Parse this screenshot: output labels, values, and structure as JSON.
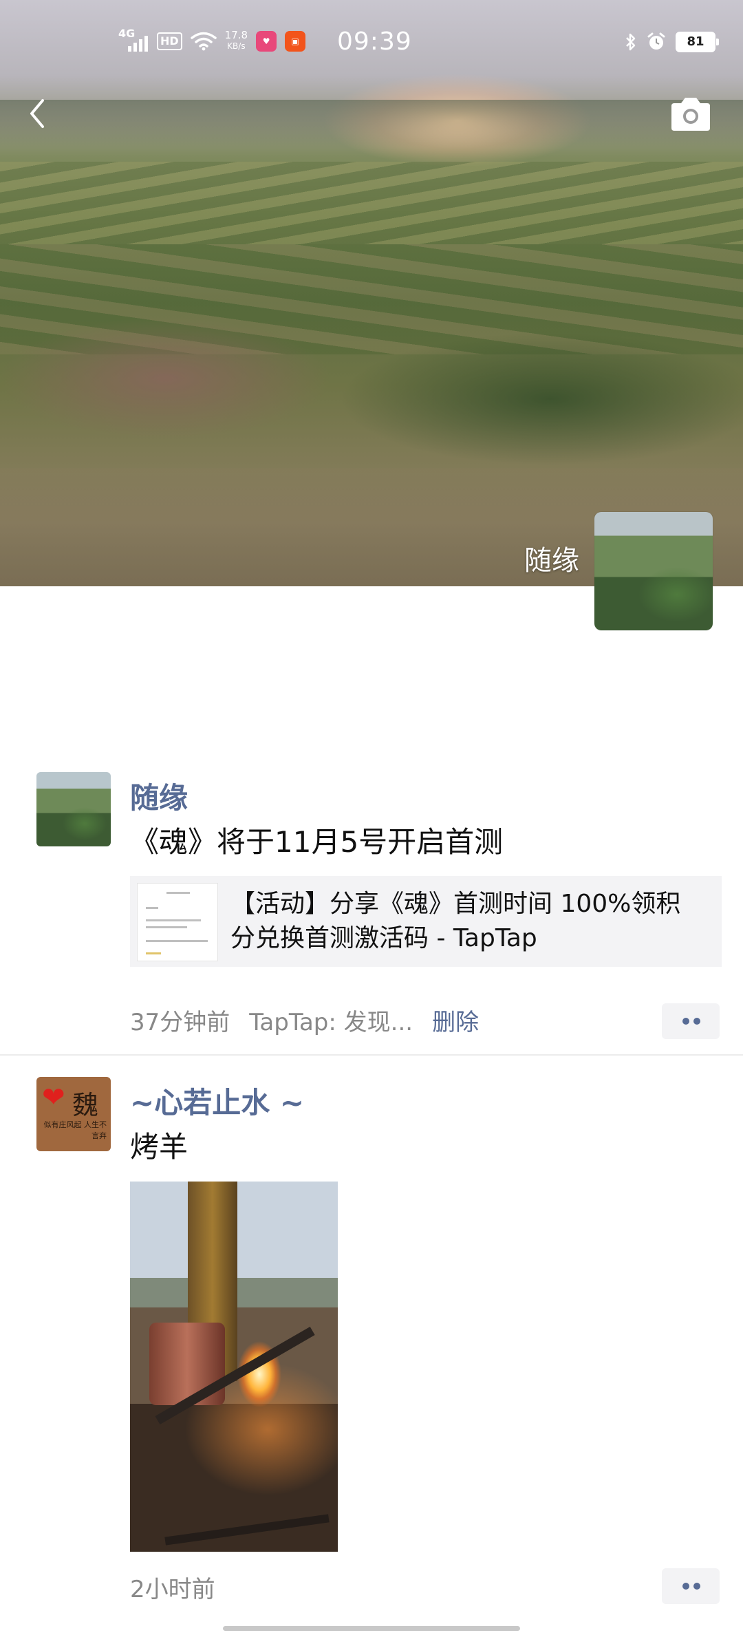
{
  "status_bar": {
    "network": "4G",
    "hd": "HD",
    "speed_value": "17.8",
    "speed_unit": "KB/s",
    "time": "09:39",
    "battery": "81",
    "app1_color": "#e8487a",
    "app2_color": "#f2541b"
  },
  "header": {
    "back_icon": "chevron-left-icon",
    "camera_icon": "camera-icon"
  },
  "cover": {
    "owner_name": "随缘"
  },
  "posts": [
    {
      "nickname": "随缘",
      "text": "《魂》将于11月5号开启首测",
      "share": {
        "title": "【活动】分享《魂》首测时间 100%领积分兑换首测激活码 - TapTap"
      },
      "time": "37分钟前",
      "source": "TapTap: 发现...",
      "delete_label": "删除"
    },
    {
      "nickname": "~心若止水 ~",
      "avatar_text": "魏",
      "avatar_subtext": "似有庄风起 人生不言弃",
      "text": "烤羊",
      "time": "2小时前"
    }
  ],
  "colors": {
    "link": "#576b95",
    "meta": "#888888",
    "card_bg": "#f3f3f5"
  }
}
